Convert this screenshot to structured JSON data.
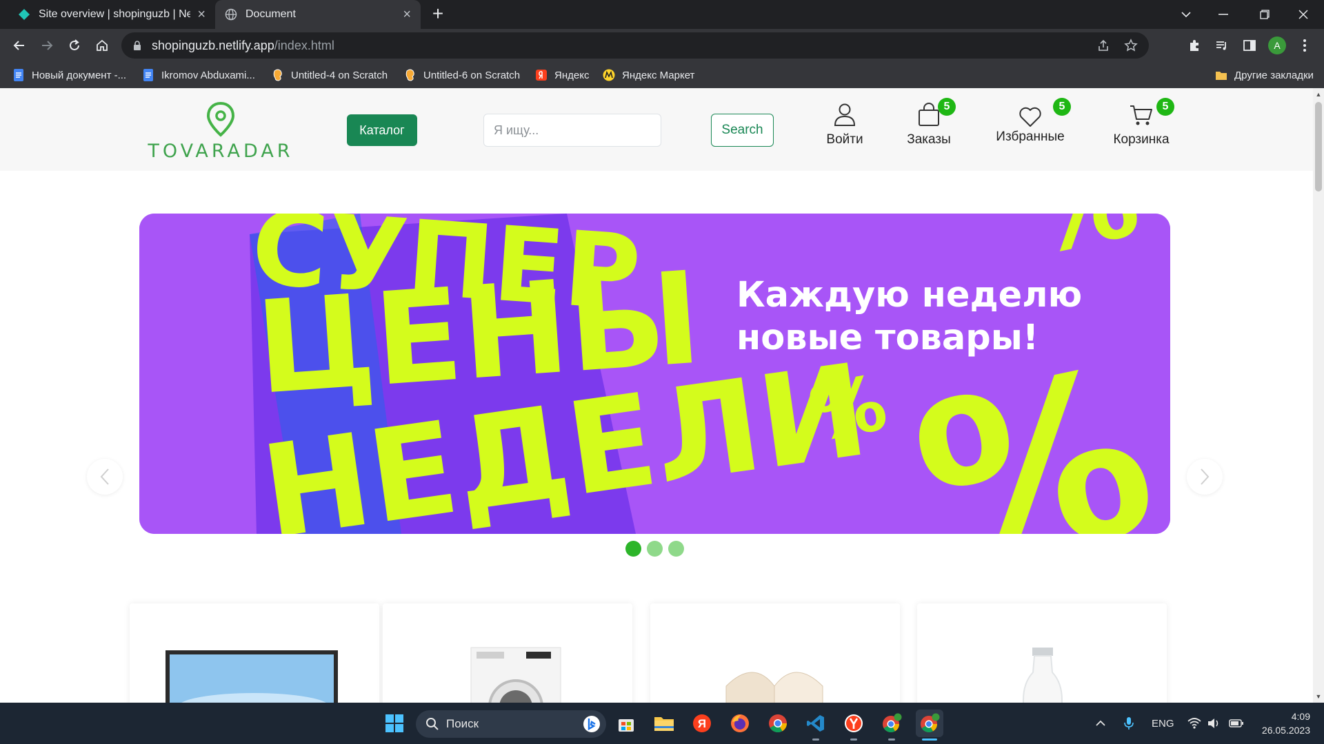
{
  "browser": {
    "tabs": [
      {
        "title": "Site overview | shopinguzb | Netl",
        "active": false,
        "icon": "netlify-icon"
      },
      {
        "title": "Document",
        "active": true,
        "icon": "globe-icon"
      }
    ],
    "url_host": "shopinguzb.netlify.app",
    "url_path": "/index.html",
    "profile_initial": "A",
    "bookmarks": [
      {
        "label": "Новый документ -...",
        "icon": "docs-icon"
      },
      {
        "label": "Ikromov Abduxami...",
        "icon": "docs-icon"
      },
      {
        "label": "Untitled-4 on Scratch",
        "icon": "scratch-icon"
      },
      {
        "label": "Untitled-6 on Scratch",
        "icon": "scratch-icon"
      },
      {
        "label": "Яндекс",
        "icon": "yandex-icon"
      },
      {
        "label": "Яндекс Маркет",
        "icon": "yandex-market-icon"
      }
    ],
    "other_bookmarks": "Другие закладки"
  },
  "site": {
    "logo_text": "TOVARADAR",
    "catalog_label": "Каталог",
    "search_placeholder": "Я ищу...",
    "search_button": "Search",
    "nav": {
      "login": {
        "label": "Войти"
      },
      "orders": {
        "label": "Заказы",
        "count": "5"
      },
      "favorites": {
        "label": "Избранные",
        "count": "5"
      },
      "cart": {
        "label": "Корзинка",
        "count": "5"
      }
    },
    "banner": {
      "big_lines": [
        "СУПЕР",
        "ЦЕНЫ",
        "НЕДЕЛИ"
      ],
      "tagline_1": "Каждую неделю",
      "tagline_2": "новые товары!",
      "percent": "%",
      "slides": 3,
      "active_slide": 1,
      "colors": {
        "background": "#a855f7",
        "accent": "#d4fc1c",
        "shadow": "#3b5bdb"
      }
    },
    "products": [
      {
        "icon": "tv-icon"
      },
      {
        "icon": "washing-machine-icon"
      },
      {
        "icon": "book-icon"
      },
      {
        "icon": "milk-bottle-icon"
      }
    ]
  },
  "taskbar": {
    "search_label": "Поиск",
    "language": "ENG",
    "time": "4:09",
    "date": "26.05.2023"
  }
}
